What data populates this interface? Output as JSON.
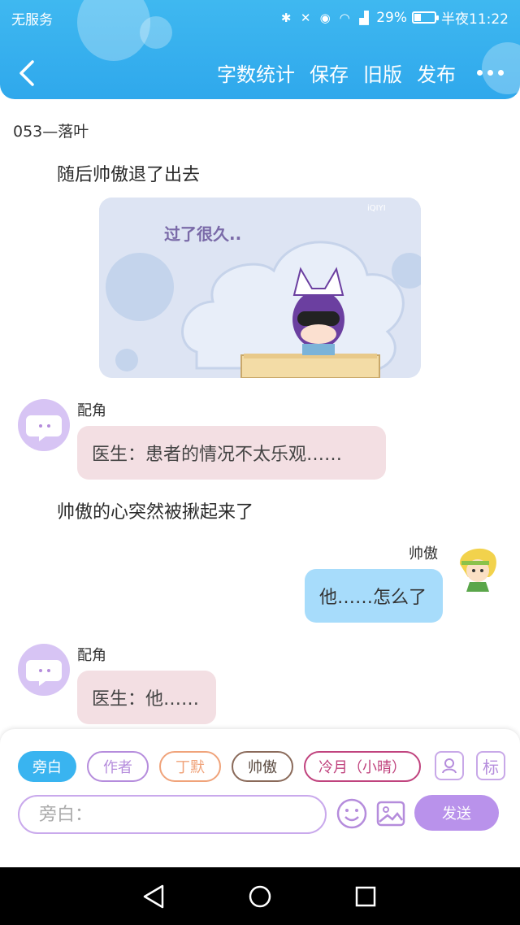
{
  "status_bar": {
    "carrier": "无服务",
    "battery": "29%",
    "time": "半夜11:22"
  },
  "header": {
    "actions": [
      "字数统计",
      "保存",
      "旧版",
      "发布"
    ]
  },
  "story": {
    "chapter_title": "053—落叶",
    "narration_1": "随后帅傲退了出去",
    "image_caption": "过了很久..",
    "image_watermark": "iQIYI",
    "narration_2": "帅傲的心突然被揪起来了"
  },
  "messages": [
    {
      "speaker": "配角",
      "text": "医生：患者的情况不太乐观……"
    },
    {
      "speaker": "帅傲",
      "text": "他……怎么了"
    },
    {
      "speaker": "配角",
      "text": "医生：他……"
    }
  ],
  "composer": {
    "roles": [
      "旁白",
      "作者",
      "丁默",
      "帅傲",
      "冷月（小晴）"
    ],
    "role_colors": {
      "旁白": "#39b4f0",
      "作者": "#b58cdc",
      "丁默": "#f0a37a",
      "帅傲": "#8a6a5a",
      "冷月（小晴）": "#c0437e"
    },
    "tag_label": "标",
    "input_placeholder": "旁白：",
    "send_label": "发送"
  },
  "colors": {
    "header": "#3fb8f0",
    "accent_purple": "#b992eb",
    "pink_bubble": "#f3dfe3",
    "blue_bubble": "#a7dcfb"
  }
}
